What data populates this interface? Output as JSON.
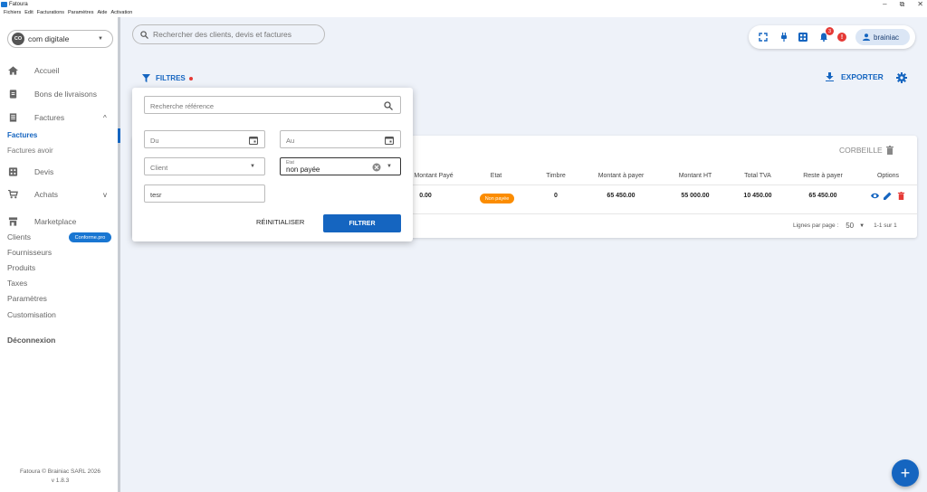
{
  "window": {
    "title": "Fatoura",
    "minimize": "–",
    "restore": "⧉",
    "close": "✕"
  },
  "menu": [
    "Fichiers",
    "Edit",
    "Facturations",
    "Paramètres",
    "Aide",
    "Activation"
  ],
  "company": {
    "avatar_text": "CO",
    "name": "com digitale"
  },
  "sidebar": {
    "accueil": "Accueil",
    "bons": "Bons de livraisons",
    "factures": "Factures",
    "factures_sub": "Factures",
    "factures_avoir": "Factures avoir",
    "devis": "Devis",
    "achats": "Achats",
    "marketplace": "Marketplace",
    "clients": "Clients",
    "clients_badge": "Conforme.pro",
    "fournisseurs": "Fournisseurs",
    "produits": "Produits",
    "taxes": "Taxes",
    "parametres": "Paramètres",
    "customisation": "Customisation",
    "logout": "Déconnexion",
    "footer_line1": "Fatoura © Brainiac SARL 2026",
    "footer_line2": "v 1.8.3"
  },
  "header": {
    "search_placeholder": "Rechercher des clients, devis et factures",
    "notif_count": "3",
    "alert": "!",
    "user": "brainiac"
  },
  "toolbar": {
    "filters": "FILTRES",
    "export": "EXPORTER"
  },
  "filter_panel": {
    "reference_placeholder": "Recherche référence",
    "du": "Du",
    "au": "Au",
    "client": "Client",
    "etat_label": "Etat",
    "etat_value": "non payée",
    "text_value": "tesr",
    "reset": "RÉINITIALISER",
    "filter": "FILTRER"
  },
  "table": {
    "corbeille": "CORBEILLE",
    "headers": [
      "Montant Payé",
      "Etat",
      "Timbre",
      "Montant à payer",
      "Montant HT",
      "Total TVA",
      "Reste à payer",
      "Options"
    ],
    "row": {
      "montant_paye": "0.00",
      "etat": "Non payée",
      "timbre": "0",
      "montant_a_payer": "65 450.00",
      "montant_ht": "55 000.00",
      "total_tva": "10 450.00",
      "reste": "65 450.00"
    },
    "pagination": {
      "label": "Lignes par page :",
      "value": "50",
      "range": "1-1 sur 1"
    }
  },
  "colors": {
    "primary": "#1565c0",
    "danger": "#e53935",
    "warning": "#fb8c00",
    "background": "#eef2f9"
  }
}
